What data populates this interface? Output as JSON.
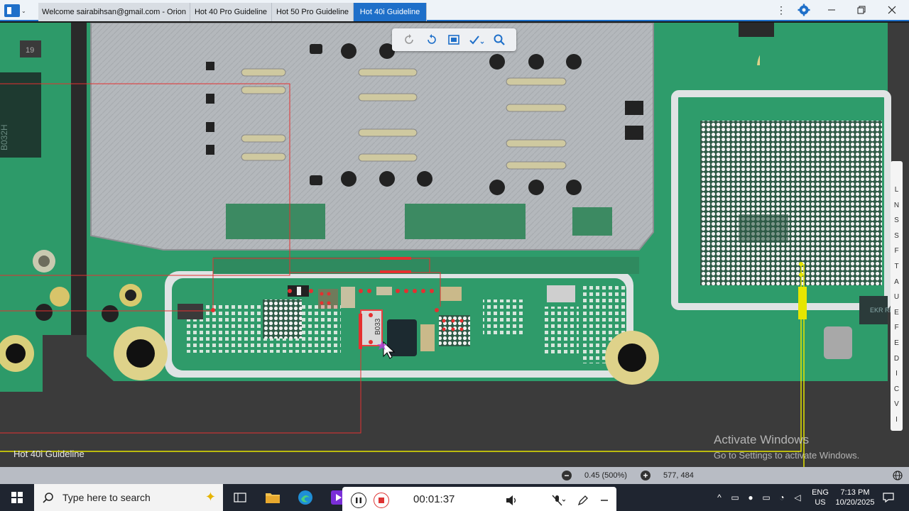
{
  "window": {
    "tabs": [
      {
        "label": "Welcome sairabihsan@gmail.com - Orion",
        "active": false
      },
      {
        "label": "Hot 40 Pro Guideline",
        "active": false
      },
      {
        "label": "Hot 50 Pro Guideline",
        "active": false
      },
      {
        "label": "Hot 40i Guideline",
        "active": true
      }
    ],
    "controls": {
      "more_icon": "vertical-dots-icon",
      "settings_icon": "gear-icon",
      "minimize_icon": "minimize-icon",
      "restore_icon": "restore-icon",
      "close_icon": "close-icon"
    },
    "accent_color": "#1e6fc9"
  },
  "viewer_toolbar": {
    "buttons": [
      "rotate-left-icon",
      "rotate-right-icon",
      "fit-screen-icon",
      "draw-check-icon",
      "search-icon"
    ]
  },
  "canvas": {
    "component_labels": [
      "19",
      "B032H",
      "B033",
      "EKR RM"
    ],
    "bottom_label": "Hot 40i Guideline",
    "right_panel_letters": [
      "L",
      "N",
      "S",
      "S",
      "F",
      "T",
      "A",
      "U",
      "E",
      "F",
      "E",
      "D",
      "I",
      "C",
      "V",
      "I"
    ],
    "watermark": {
      "line1": "Activate Windows",
      "line2": "Go to Settings to activate Windows."
    }
  },
  "statusbar": {
    "zoom": "0.45 (500%)",
    "coordinates": "577, 484",
    "zoom_out_icon": "minus-icon",
    "zoom_in_icon": "plus-icon",
    "globe_icon": "globe-icon"
  },
  "taskbar": {
    "search_placeholder": "Type here to search",
    "recorder": {
      "time": "00:01:37"
    },
    "tray": {
      "language": "ENG",
      "region": "US",
      "time": "7:13 PM",
      "date": "10/20/2025"
    }
  }
}
